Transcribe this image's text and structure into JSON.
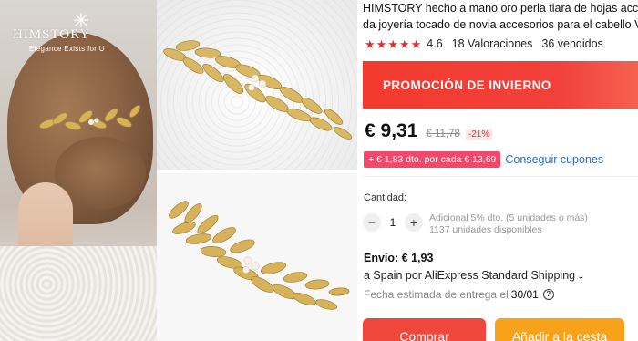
{
  "brand": {
    "logo_text": "HIMSTORY",
    "tagline": "Elegance Exists for U"
  },
  "product": {
    "title_line1": "HIMSTORY hecho a mano oro perla tiara de hojas accesorio",
    "title_line2": "da joyería tocado de novia accesorios para el cabello Vin",
    "rating": "4.6",
    "star_count": 5,
    "ratings_label": "18 Valoraciones",
    "sold_label": "36 vendidos"
  },
  "promo": {
    "label": "PROMOCIÓN DE INVIERNO",
    "color": "#f23b2e"
  },
  "price": {
    "current": "€ 9,31",
    "original": "€ 11,78",
    "discount": "-21%"
  },
  "coupon": {
    "tag": "+ € 1,83 dto. por cada € 13,69",
    "link": "Conseguir cupones"
  },
  "quantity": {
    "label": "Cantidad:",
    "minus": "−",
    "value": "1",
    "plus": "+",
    "note_line1": "Adicional 5% dto. (5 unidades o más)",
    "note_line2": "1137 unidades disponibles"
  },
  "shipping": {
    "price": "Envío: € 1,93",
    "route": "a Spain por AliExpress Standard Shipping",
    "route_chevron": "⌄",
    "delivery_prefix": "Fecha estimada de entrega el",
    "delivery_date": "30/01",
    "help_icon": "?"
  },
  "actions": {
    "buy": "Comprar",
    "add_to_cart": "Añadir a la cesta",
    "buy_color": "#f0473c",
    "cart_color": "#f7a21a"
  }
}
